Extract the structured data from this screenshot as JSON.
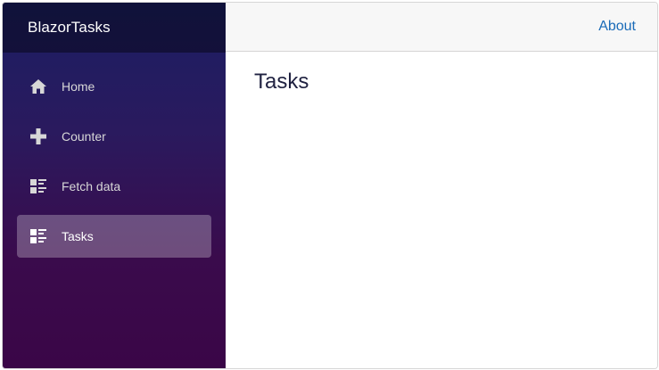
{
  "app": {
    "brand": "BlazorTasks"
  },
  "sidebar": {
    "items": [
      {
        "label": "Home",
        "icon": "home-icon",
        "active": false
      },
      {
        "label": "Counter",
        "icon": "plus-icon",
        "active": false
      },
      {
        "label": "Fetch data",
        "icon": "list-rich-icon",
        "active": false
      },
      {
        "label": "Tasks",
        "icon": "list-rich-icon",
        "active": true
      }
    ]
  },
  "top_row": {
    "about_label": "About"
  },
  "main": {
    "title": "Tasks"
  },
  "colors": {
    "sidebar_top": "#1b1e63",
    "sidebar_bottom": "#3a0647",
    "link": "#1a6bb8",
    "active_item_bg": "rgba(255,255,255,0.27)"
  }
}
